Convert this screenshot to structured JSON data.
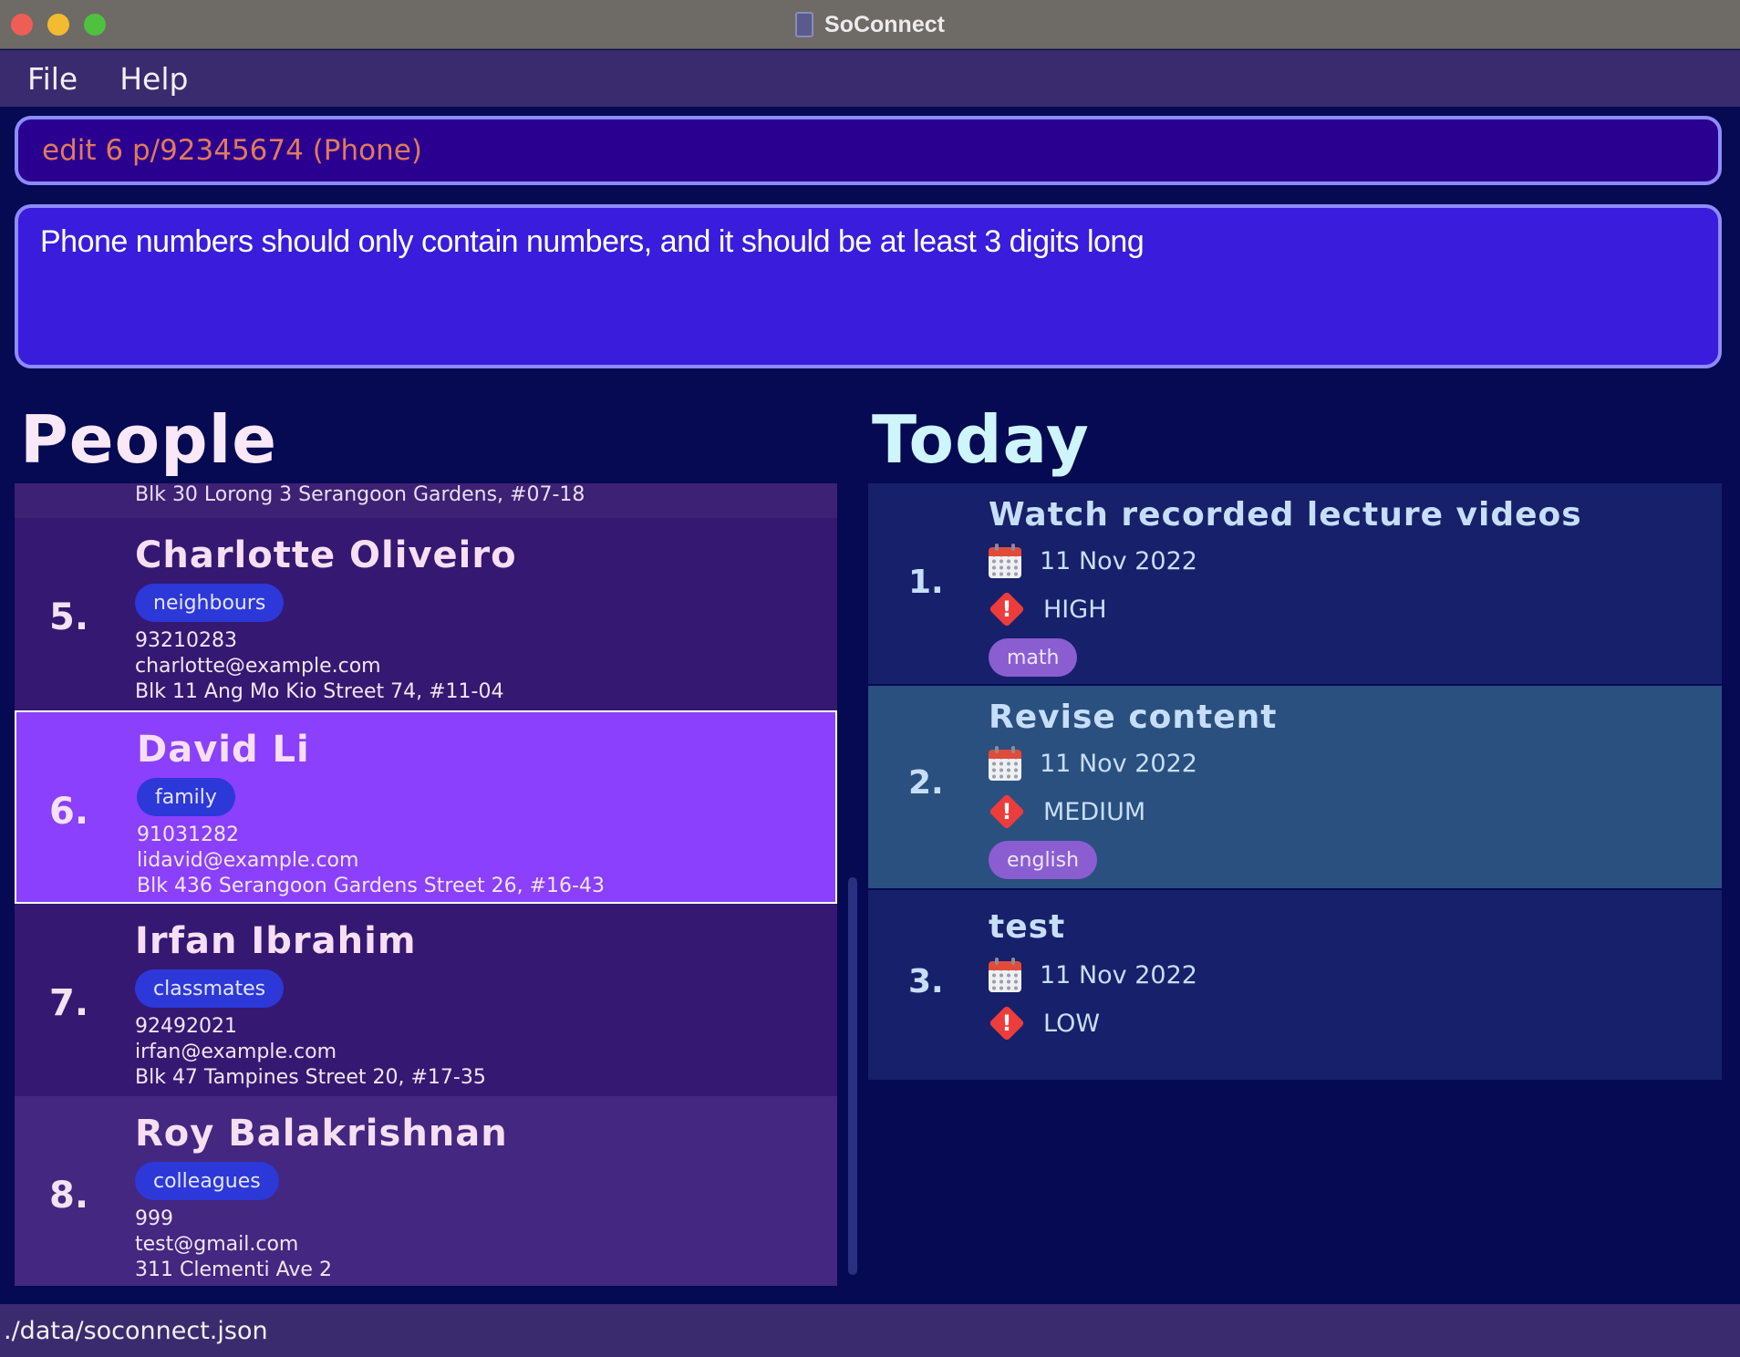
{
  "window": {
    "title": "SoConnect"
  },
  "menu": {
    "items": [
      "File",
      "Help"
    ]
  },
  "command": {
    "value": "edit 6 p/92345674 (Phone)"
  },
  "result": {
    "text": "Phone numbers should only contain numbers, and it should be at least 3 digits long"
  },
  "people": {
    "header": "People",
    "partial_address": "Blk 30 Lorong 3 Serangoon Gardens, #07-18",
    "cards": [
      {
        "index": "5.",
        "name": "Charlotte Oliveiro",
        "tag": "neighbours",
        "phone": "93210283",
        "email": "charlotte@example.com",
        "address": "Blk 11 Ang Mo Kio Street 74, #11-04"
      },
      {
        "index": "6.",
        "name": "David Li",
        "tag": "family",
        "phone": "91031282",
        "email": "lidavid@example.com",
        "address": "Blk 436 Serangoon Gardens Street 26, #16-43",
        "selected": true
      },
      {
        "index": "7.",
        "name": "Irfan Ibrahim",
        "tag": "classmates",
        "phone": "92492021",
        "email": "irfan@example.com",
        "address": "Blk 47 Tampines Street 20, #17-35"
      },
      {
        "index": "8.",
        "name": "Roy Balakrishnan",
        "tag": "colleagues",
        "phone": "999",
        "email": "test@gmail.com",
        "address": "311 Clementi Ave 2"
      }
    ]
  },
  "today": {
    "header": "Today",
    "tasks": [
      {
        "index": "1.",
        "name": "Watch recorded lecture videos",
        "date": "11 Nov 2022",
        "priority": "HIGH",
        "tag": "math"
      },
      {
        "index": "2.",
        "name": "Revise content",
        "date": "11 Nov 2022",
        "priority": "MEDIUM",
        "tag": "english"
      },
      {
        "index": "3.",
        "name": "test",
        "date": "11 Nov 2022",
        "priority": "LOW"
      }
    ]
  },
  "status": {
    "path": "./data/soconnect.json"
  },
  "colors": {
    "background": "#050a52",
    "selected_card": "#8a40fc",
    "person_tag": "#2c38d8",
    "task_tag": "#8a5ed0",
    "command_text": "#e07a5a"
  },
  "icons": {
    "date": "calendar-icon",
    "priority": "priority-warning-icon"
  }
}
